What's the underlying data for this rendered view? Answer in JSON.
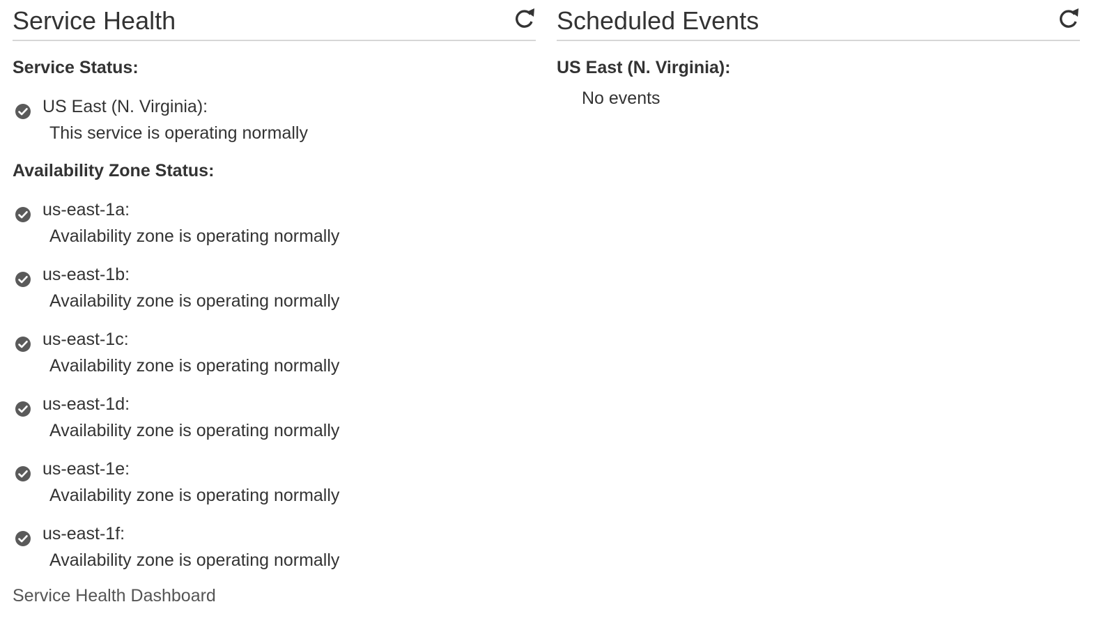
{
  "service_health": {
    "title": "Service Health",
    "refresh_icon": "refresh-icon",
    "service_status_heading": "Service Status:",
    "service_status": {
      "region": "US East (N. Virginia):",
      "message": "This service is operating normally",
      "icon": "check-circle-icon"
    },
    "az_status_heading": "Availability Zone Status:",
    "zones": [
      {
        "name": "us-east-1a:",
        "message": "Availability zone is operating normally",
        "icon": "check-circle-icon"
      },
      {
        "name": "us-east-1b:",
        "message": "Availability zone is operating normally",
        "icon": "check-circle-icon"
      },
      {
        "name": "us-east-1c:",
        "message": "Availability zone is operating normally",
        "icon": "check-circle-icon"
      },
      {
        "name": "us-east-1d:",
        "message": "Availability zone is operating normally",
        "icon": "check-circle-icon"
      },
      {
        "name": "us-east-1e:",
        "message": "Availability zone is operating normally",
        "icon": "check-circle-icon"
      },
      {
        "name": "us-east-1f:",
        "message": "Availability zone is operating normally",
        "icon": "check-circle-icon"
      }
    ],
    "dashboard_link": "Service Health Dashboard"
  },
  "scheduled_events": {
    "title": "Scheduled Events",
    "refresh_icon": "refresh-icon",
    "region": "US East (N. Virginia):",
    "message": "No events"
  },
  "colors": {
    "text": "#333333",
    "divider": "#d6d6d6",
    "status_ok_icon": "#5a5a5a",
    "link": "#555555"
  }
}
